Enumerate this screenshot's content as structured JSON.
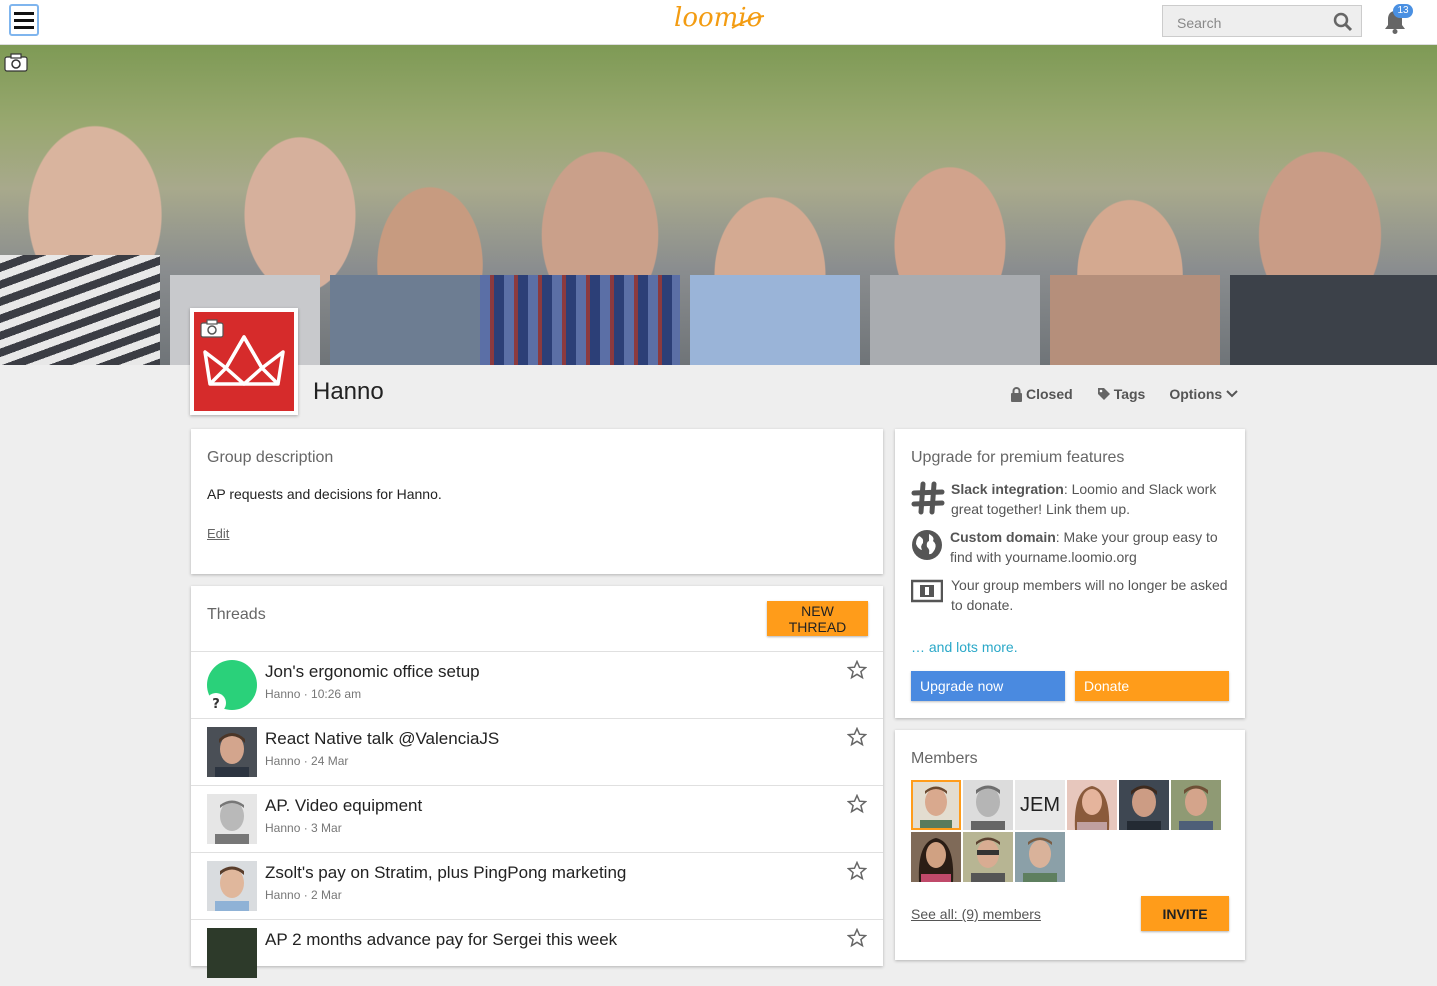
{
  "topbar": {
    "brand": "loomio",
    "search_placeholder": "Search",
    "notification_count": "13"
  },
  "group": {
    "name": "Hanno",
    "actions": {
      "privacy": "Closed",
      "tags": "Tags",
      "options": "Options"
    }
  },
  "description_card": {
    "title": "Group description",
    "text": "AP requests and decisions for Hanno.",
    "edit": "Edit"
  },
  "threads_card": {
    "title": "Threads",
    "new_thread": "NEW THREAD",
    "threads": [
      {
        "title": "Jon's ergonomic office setup",
        "meta": "Hanno · 10:26 am"
      },
      {
        "title": "React Native talk @ValenciaJS",
        "meta": "Hanno · 24 Mar"
      },
      {
        "title": "AP. Video equipment",
        "meta": "Hanno · 3 Mar"
      },
      {
        "title": "Zsolt's pay on Stratim, plus PingPong marketing",
        "meta": "Hanno · 2 Mar"
      },
      {
        "title": "AP 2 months advance pay for Sergei this week",
        "meta": ""
      }
    ]
  },
  "upgrade_card": {
    "title": "Upgrade for premium features",
    "features": [
      {
        "bold": "Slack integration",
        "text": ": Loomio and Slack work great together! Link them up.",
        "icon": "slack-icon"
      },
      {
        "bold": "Custom domain",
        "text": ": Make your group easy to find with yourname.loomio.org",
        "icon": "globe-icon"
      },
      {
        "bold": "",
        "text": "Your group members will no longer be asked to donate.",
        "icon": "money-icon"
      }
    ],
    "more": "… and lots more.",
    "upgrade": "Upgrade now",
    "donate": "Donate",
    "colors": {
      "upgrade": "#4a8ae0",
      "donate": "#ff9c1a"
    }
  },
  "members_card": {
    "title": "Members",
    "initials_member": "JEM",
    "see_all": "See all: (9) members",
    "invite": "INVITE"
  }
}
